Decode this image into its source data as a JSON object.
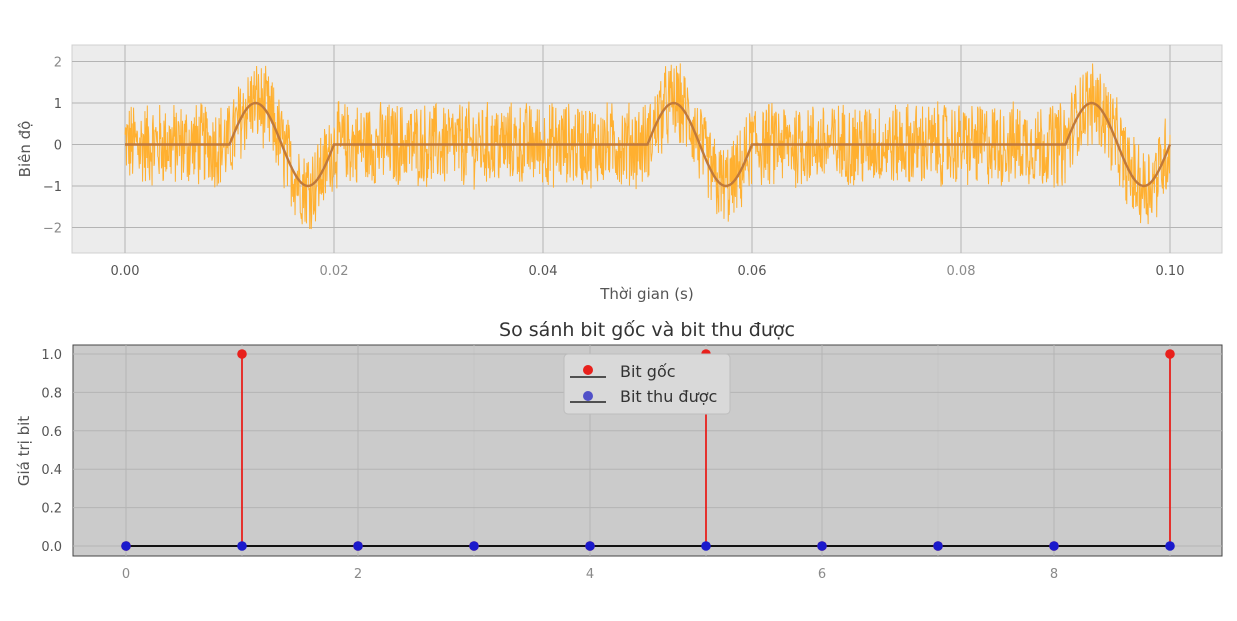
{
  "chart_data": [
    {
      "type": "line",
      "title": "",
      "xlabel": "Thời gian (s)",
      "ylabel": "Biên độ",
      "xlim": [
        0.0,
        0.1
      ],
      "ylim": [
        -2.5,
        2.5
      ],
      "xticks": [
        0.0,
        0.02,
        0.04,
        0.06,
        0.08,
        0.1
      ],
      "xtick_labels": [
        "0.00",
        "0.02",
        "0.04",
        "0.06",
        "0.08",
        "0.10"
      ],
      "yticks": [
        -2,
        -1,
        0,
        1,
        2
      ],
      "ytick_labels": [
        "−2",
        "−1",
        "0",
        "1",
        "2"
      ],
      "grid": true,
      "series": [
        {
          "name": "",
          "color": "#ffb030",
          "description_values": "noisy signal = clean signal + noise (amplitude about ±1)",
          "noise_amplitude": 1.0
        },
        {
          "name": "",
          "color": "#c0793a",
          "x": [
            0.0,
            0.01,
            0.0125,
            0.015,
            0.0175,
            0.02,
            0.05,
            0.0525,
            0.055,
            0.0575,
            0.06,
            0.09,
            0.0925,
            0.095,
            0.0975,
            0.1
          ],
          "y": [
            0,
            0,
            1,
            0,
            -1,
            0,
            0,
            1,
            0,
            -1,
            0,
            0,
            1,
            0,
            -1,
            0
          ]
        }
      ]
    },
    {
      "type": "stem",
      "title": "So sánh bit gốc và bit thu được",
      "xlabel": "",
      "ylabel": "Giá trị bit",
      "xlim": [
        -0.4,
        9.4
      ],
      "ylim": [
        -0.05,
        1.05
      ],
      "yticks": [
        0.0,
        0.2,
        0.4,
        0.6,
        0.8,
        1.0
      ],
      "ytick_labels": [
        "0.0",
        "0.2",
        "0.4",
        "0.6",
        "0.8",
        "1.0"
      ],
      "xtick_labels_visible": [
        "0",
        "2",
        "4",
        "6",
        "8"
      ],
      "xtick_positions": [
        0,
        2,
        4,
        6,
        8
      ],
      "grid": true,
      "legend_position": "top-center",
      "series": [
        {
          "name": "Bit gốc",
          "color": "#e8201c",
          "x": [
            0,
            1,
            2,
            3,
            4,
            5,
            6,
            7,
            8,
            9
          ],
          "y": [
            0,
            1,
            0,
            0,
            0,
            1,
            0,
            0,
            0,
            1
          ]
        },
        {
          "name": "Bit thu được",
          "color": "#1a1acc",
          "x": [
            0,
            1,
            2,
            3,
            4,
            5,
            6,
            7,
            8,
            9
          ],
          "y": [
            0,
            0,
            0,
            0,
            0,
            0,
            0,
            0,
            0,
            0
          ]
        }
      ]
    }
  ]
}
